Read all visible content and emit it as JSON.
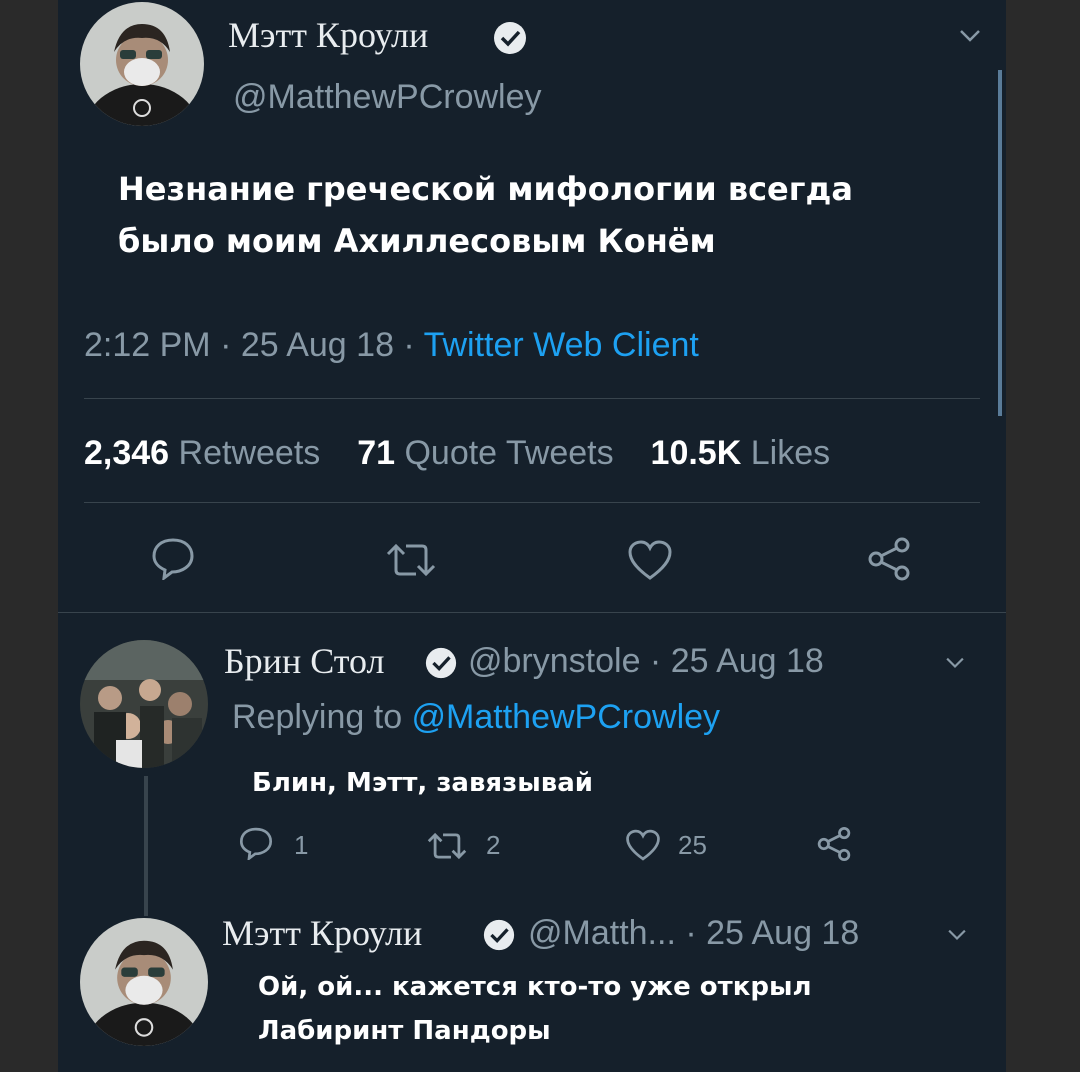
{
  "main_tweet": {
    "author_name": "Мэтт Кроули",
    "handle": "@MatthewPCrowley",
    "text_line1": "Незнание греческой мифологии всегда",
    "text_line2": "было моим Ахиллесовым Конём",
    "time": "2:12 PM · 25 Aug 18 · ",
    "source": "Twitter Web Client",
    "stats": {
      "retweets_num": "2,346",
      "retweets_label": "Retweets",
      "quotes_num": "71",
      "quotes_label": "Quote Tweets",
      "likes_num": "10.5K",
      "likes_label": "Likes"
    }
  },
  "reply_1": {
    "author_name": "Брин Стол",
    "handle_date": "@brynstole · 25 Aug 18",
    "replying_prefix": "Replying to ",
    "replying_handle": "@MatthewPCrowley",
    "text": "Блин, Мэтт, завязывай",
    "reply_count": "1",
    "retweet_count": "2",
    "like_count": "25"
  },
  "reply_2": {
    "author_name": "Мэтт Кроули",
    "handle_date": "@Matth... · 25 Aug 18",
    "text_line1": "Ой, ой... кажется кто-то уже открыл",
    "text_line2": "Лабиринт Пандоры"
  },
  "colors": {
    "background": "#15202b",
    "accent": "#1da1f2",
    "muted": "#8899a6",
    "divider": "#38444d"
  }
}
